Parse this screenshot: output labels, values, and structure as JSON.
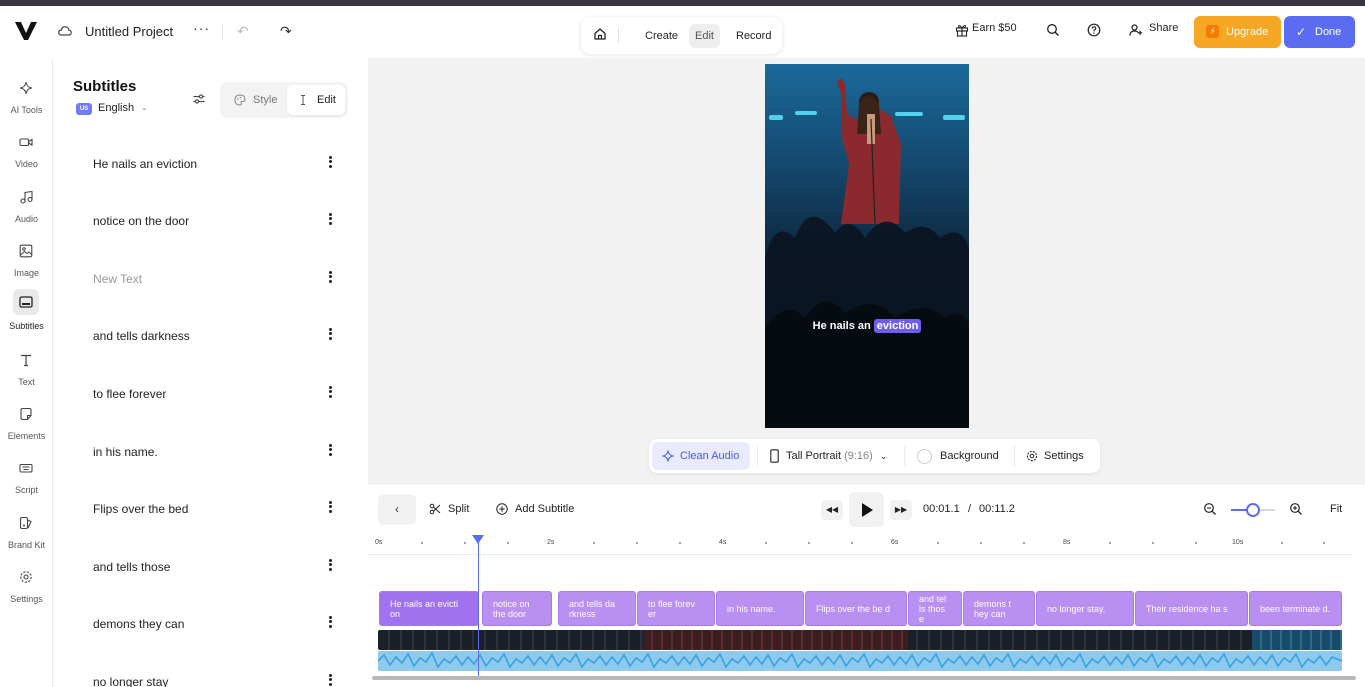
{
  "header": {
    "project_title": "Untitled Project",
    "modes": [
      "Create",
      "Edit",
      "Record"
    ],
    "active_mode": "Edit",
    "earn_label": "Earn $50",
    "share_label": "Share",
    "upgrade_label": "Upgrade",
    "done_label": "Done"
  },
  "nav": {
    "items": [
      {
        "label": "AI Tools",
        "icon": "sparkle-icon"
      },
      {
        "label": "Video",
        "icon": "video-camera-icon"
      },
      {
        "label": "Audio",
        "icon": "music-note-icon"
      },
      {
        "label": "Image",
        "icon": "image-icon"
      },
      {
        "label": "Subtitles",
        "icon": "subtitles-icon"
      },
      {
        "label": "Text",
        "icon": "text-icon"
      },
      {
        "label": "Elements",
        "icon": "sticker-icon"
      },
      {
        "label": "Script",
        "icon": "keyboard-icon"
      },
      {
        "label": "Brand Kit",
        "icon": "palette-icon"
      },
      {
        "label": "Settings",
        "icon": "gear-icon"
      }
    ],
    "active": "Subtitles"
  },
  "panel": {
    "title": "Subtitles",
    "language_badge": "US",
    "language": "English",
    "style_tab": "Style",
    "edit_tab": "Edit",
    "subtitles": [
      {
        "text": "He nails an eviction"
      },
      {
        "text": "notice on the door"
      },
      {
        "text": "New Text",
        "placeholder": true
      },
      {
        "text": "and tells darkness"
      },
      {
        "text": "to flee forever"
      },
      {
        "text": "in his name."
      },
      {
        "text": "Flips over the bed"
      },
      {
        "text": "and tells those"
      },
      {
        "text": "demons they can"
      },
      {
        "text": "no longer stay"
      }
    ]
  },
  "preview": {
    "caption_before": "He nails an",
    "caption_highlight": "eviction"
  },
  "preview_toolbar": {
    "clean_audio": "Clean Audio",
    "ratio": "Tall Portrait",
    "ratio_value": "(9:16)",
    "background": "Background",
    "settings": "Settings"
  },
  "timeline": {
    "split_label": "Split",
    "add_subtitle_label": "Add Subtitle",
    "current_time": "00:01.1",
    "separator": "/",
    "total_time": "00:11.2",
    "fit_label": "Fit",
    "zoom_level": 0.5,
    "ruler_labels": [
      "0s",
      "2s",
      "4s",
      "6s",
      "8s",
      "10s"
    ],
    "clips": [
      "He nails an evicti on",
      "notice on the door",
      "and tells da rkness",
      "to flee forev er",
      "in his name.",
      "Flips over the be d",
      "and tel ls thos e",
      "demons t hey can",
      "no longer stay.",
      "Their residence ha s",
      "been terminate d."
    ]
  },
  "colors": {
    "accent": "#5b6cf3",
    "upgrade": "#f6a723",
    "clip": "#b98ff2",
    "caption_highlight": "#6f5cf0"
  }
}
